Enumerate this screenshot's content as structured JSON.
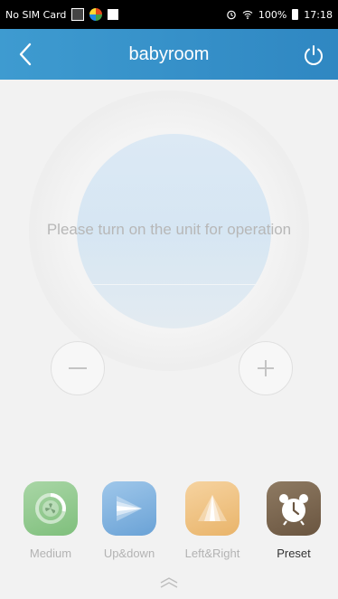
{
  "status_bar": {
    "carrier": "No SIM Card",
    "battery": "100%",
    "time": "17:18",
    "icons": [
      "notification-icon",
      "app-icon",
      "grid-icon",
      "alarm-icon",
      "wifi-icon",
      "battery-icon"
    ]
  },
  "nav": {
    "title": "babyroom",
    "back_icon": "chevron-left-icon",
    "power_icon": "power-icon",
    "bar_color": "#3e9bd0"
  },
  "dial": {
    "notice": "Please turn on the unit for operation",
    "minus_icon": "minus-icon",
    "plus_icon": "plus-icon"
  },
  "modes": [
    {
      "label": "Medium",
      "icon": "fan-speed-icon",
      "active": false
    },
    {
      "label": "Up&down",
      "icon": "swing-updown-icon",
      "active": false
    },
    {
      "label": "Left&Right",
      "icon": "swing-leftright-icon",
      "active": false
    },
    {
      "label": "Preset",
      "icon": "alarm-clock-icon",
      "active": true
    }
  ],
  "footer": {
    "expand_icon": "chevron-up-icon"
  }
}
